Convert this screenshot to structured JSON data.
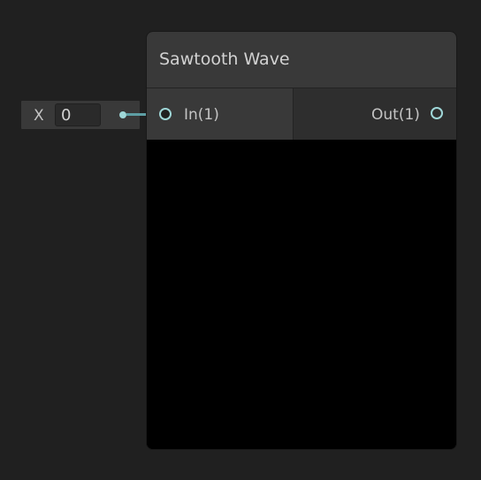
{
  "graph": {
    "background_color": "#202020"
  },
  "input_field": {
    "axis_label": "X",
    "value": "0"
  },
  "node": {
    "title": "Sawtooth Wave",
    "inputs": [
      {
        "label": "In(1)",
        "connected": true
      }
    ],
    "outputs": [
      {
        "label": "Out(1)",
        "connected": false
      }
    ],
    "port_color": "#9fd7d8",
    "edge_color": "#5e9ea4",
    "preview_color": "#000000"
  }
}
